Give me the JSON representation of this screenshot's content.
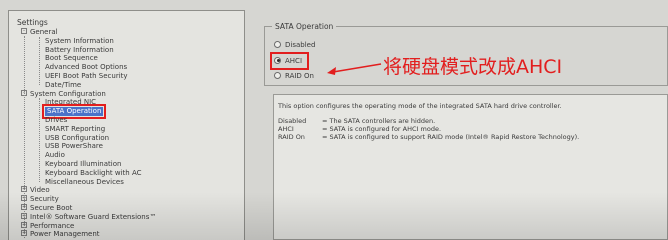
{
  "tree": {
    "title": "Settings",
    "items": [
      {
        "label": "General",
        "level": 1,
        "expander": "-"
      },
      {
        "label": "System Information",
        "level": 2
      },
      {
        "label": "Battery Information",
        "level": 2
      },
      {
        "label": "Boot Sequence",
        "level": 2
      },
      {
        "label": "Advanced Boot Options",
        "level": 2
      },
      {
        "label": "UEFI Boot Path Security",
        "level": 2
      },
      {
        "label": "Date/Time",
        "level": 2
      },
      {
        "label": "System Configuration",
        "level": 1,
        "expander": "-"
      },
      {
        "label": "Integrated NIC",
        "level": 2
      },
      {
        "label": "SATA Operation",
        "level": 2,
        "selected": true
      },
      {
        "label": "Drives",
        "level": 2
      },
      {
        "label": "SMART Reporting",
        "level": 2
      },
      {
        "label": "USB Configuration",
        "level": 2
      },
      {
        "label": "USB PowerShare",
        "level": 2
      },
      {
        "label": "Audio",
        "level": 2
      },
      {
        "label": "Keyboard Illumination",
        "level": 2
      },
      {
        "label": "Keyboard Backlight with AC",
        "level": 2
      },
      {
        "label": "Miscellaneous Devices",
        "level": 2
      },
      {
        "label": "Video",
        "level": 1,
        "expander": "+"
      },
      {
        "label": "Security",
        "level": 1,
        "expander": "+"
      },
      {
        "label": "Secure Boot",
        "level": 1,
        "expander": "+"
      },
      {
        "label": "Intel® Software Guard Extensions™",
        "level": 1,
        "expander": "+"
      },
      {
        "label": "Performance",
        "level": 1,
        "expander": "+"
      },
      {
        "label": "Power Management",
        "level": 1,
        "expander": "+"
      }
    ]
  },
  "sata": {
    "group_title": "SATA Operation",
    "options": [
      {
        "label": "Disabled",
        "checked": false
      },
      {
        "label": "AHCI",
        "checked": true
      },
      {
        "label": "RAID On",
        "checked": false
      }
    ]
  },
  "annotation": {
    "text": "将硬盘模式改成AHCI",
    "color": "#e21e1e"
  },
  "help": {
    "description": "This option configures the operating mode of the integrated SATA hard drive controller.",
    "rows": [
      {
        "key": "Disabled",
        "value": "= The SATA controllers are hidden."
      },
      {
        "key": "AHCI",
        "value": "= SATA is configured for AHCI mode."
      },
      {
        "key": "RAID On",
        "value": "= SATA is configured to support RAID mode (Intel® Rapid Restore Technology)."
      }
    ]
  },
  "colors": {
    "selection": "#4a72c9",
    "highlight_box": "#e21e1e"
  }
}
